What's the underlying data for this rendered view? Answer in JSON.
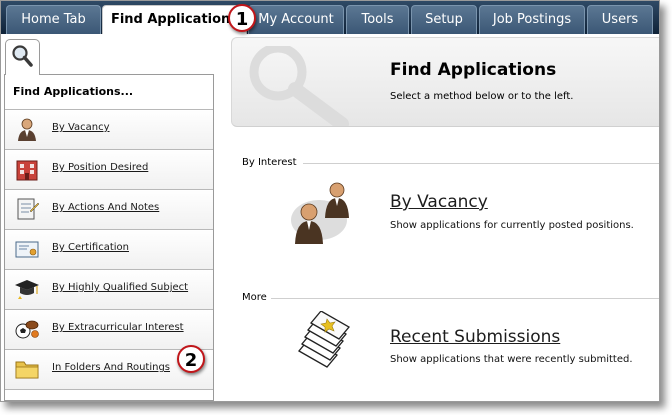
{
  "tabs": [
    {
      "label": "Home Tab",
      "active": false
    },
    {
      "label": "Find Applications",
      "active": true
    },
    {
      "label": "My Account",
      "active": false
    },
    {
      "label": "Tools",
      "active": false
    },
    {
      "label": "Setup",
      "active": false
    },
    {
      "label": "Job Postings",
      "active": false
    },
    {
      "label": "Users",
      "active": false
    }
  ],
  "callouts": {
    "first": "1",
    "second": "2"
  },
  "sidebar": {
    "tab_icon": "magnifier-icon",
    "heading": "Find Applications...",
    "items": [
      {
        "label": "By Vacancy",
        "icon": "person-icon"
      },
      {
        "label": "By Position Desired",
        "icon": "building-icon"
      },
      {
        "label": "By Actions And Notes",
        "icon": "notepad-icon"
      },
      {
        "label": "By Certification",
        "icon": "certificate-icon"
      },
      {
        "label": "By Highly Qualified Subject",
        "icon": "graduation-cap-icon"
      },
      {
        "label": "By Extracurricular Interest",
        "icon": "sports-balls-icon"
      },
      {
        "label": "In Folders And Routings",
        "icon": "folder-icon"
      }
    ]
  },
  "main": {
    "title": "Find Applications",
    "subtitle": "Select a method below or to the left.",
    "sections": [
      {
        "label": "By Interest",
        "card_title": "By Vacancy",
        "card_desc": "Show applications for currently posted positions.",
        "icon": "people-group-icon"
      },
      {
        "label": "More",
        "card_title": "Recent Submissions",
        "card_desc": "Show applications that were recently submitted.",
        "icon": "document-stack-icon"
      }
    ]
  },
  "colors": {
    "tabbar": "#1b3350",
    "callout_border": "#c0161a"
  }
}
